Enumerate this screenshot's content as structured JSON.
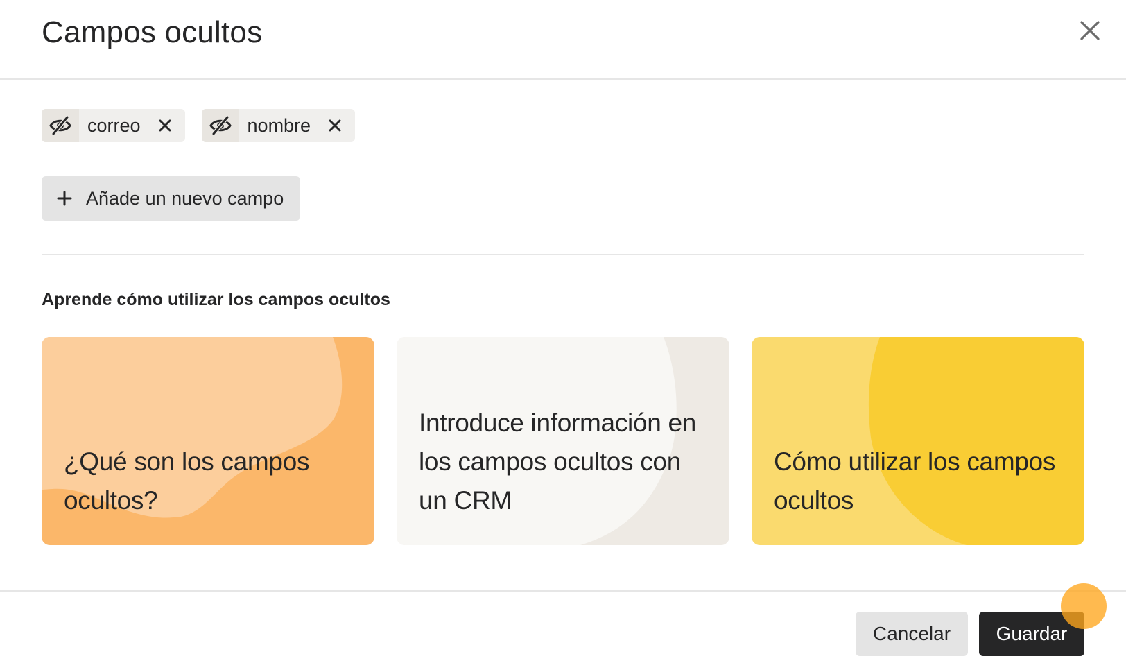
{
  "dialog": {
    "title": "Campos ocultos",
    "close_icon": "close-icon"
  },
  "hidden_fields": [
    {
      "label": "correo",
      "icon": "eye-slash-icon",
      "remove_icon": "close-icon"
    },
    {
      "label": "nombre",
      "icon": "eye-slash-icon",
      "remove_icon": "close-icon"
    }
  ],
  "add_field": {
    "label": "Añade un nuevo campo",
    "icon": "plus-icon"
  },
  "learn": {
    "heading": "Aprende cómo utilizar los campos ocultos",
    "cards": [
      {
        "text": "¿Qué son los campos ocultos?",
        "color": "#FCCE9C",
        "accent": "#FBB76A"
      },
      {
        "text": "Introduce información en los campos ocultos con un CRM",
        "color": "#F8F7F4",
        "accent": "#EEEAE4"
      },
      {
        "text": "Cómo utilizar los campos ocultos",
        "color": "#FADA6E",
        "accent": "#F9CD34"
      }
    ]
  },
  "footer": {
    "cancel_label": "Cancelar",
    "save_label": "Guardar"
  },
  "colors": {
    "text": "#262627",
    "save_button": "#262627",
    "secondary_button": "#E4E4E4",
    "cursor_highlight": "#FFA61E"
  }
}
